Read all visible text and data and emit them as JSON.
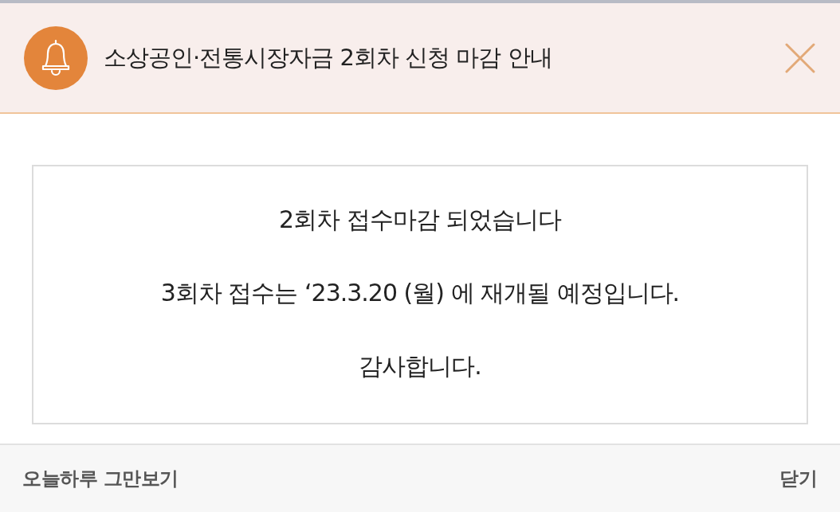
{
  "notice": {
    "title": "소상공인·전통시장자금 2회차 신청 마감 안내"
  },
  "message": {
    "lines": [
      "2회차 접수마감 되었습니다",
      "3회차 접수는 ‘23.3.20 (월) 에 재개될 예정입니다.",
      "감사합니다."
    ]
  },
  "footer": {
    "dismiss_today": "오늘하루 그만보기",
    "close": "닫기"
  }
}
